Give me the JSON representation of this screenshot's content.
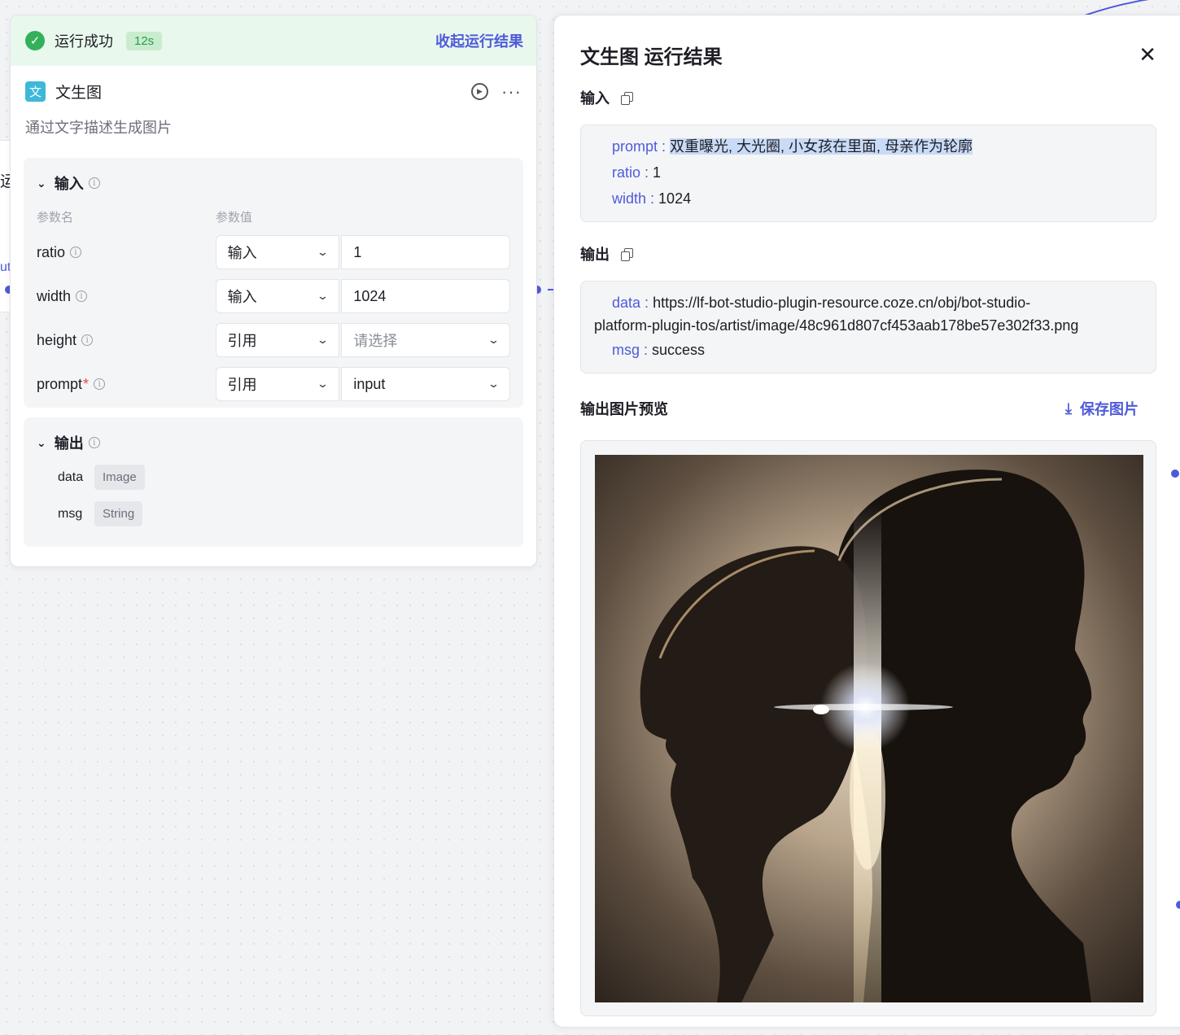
{
  "node": {
    "status": {
      "text": "运行成功",
      "duration": "12s",
      "collapse_link": "收起运行结果"
    },
    "icon_glyph": "文",
    "title": "文生图",
    "description": "通过文字描述生成图片",
    "input_section": {
      "title": "输入",
      "col_name": "参数名",
      "col_value": "参数值",
      "params": [
        {
          "name": "ratio",
          "required": false,
          "type": "输入",
          "value": "1",
          "value_is_select": false,
          "placeholder": false
        },
        {
          "name": "width",
          "required": false,
          "type": "输入",
          "value": "1024",
          "value_is_select": false,
          "placeholder": false
        },
        {
          "name": "height",
          "required": false,
          "type": "引用",
          "value": "请选择",
          "value_is_select": true,
          "placeholder": true
        },
        {
          "name": "prompt",
          "required": true,
          "type": "引用",
          "value": "input",
          "value_is_select": true,
          "placeholder": false
        }
      ],
      "required_mark": "*"
    },
    "output_section": {
      "title": "输出",
      "fields": [
        {
          "name": "data",
          "type": "Image"
        },
        {
          "name": "msg",
          "type": "String"
        }
      ]
    }
  },
  "canvas": {
    "left_stub_text": "运",
    "left_stub_text2": "ut"
  },
  "panel": {
    "title": "文生图 运行结果",
    "input_label": "输入",
    "input_kv": [
      {
        "key": "prompt",
        "value": "双重曝光, 大光圈, 小女孩在里面, 母亲作为轮廓"
      },
      {
        "key": "ratio",
        "value": "1"
      },
      {
        "key": "width",
        "value": "1024"
      }
    ],
    "output_label": "输出",
    "output_data_key": "data",
    "output_data_value_1": "https://lf-bot-studio-plugin-resource.coze.cn/obj/bot-studio-",
    "output_data_value_2": "platform-plugin-tos/artist/image/48c961d807cf453aab178be57e302f33.png",
    "output_msg_key": "msg",
    "output_msg_value": "success",
    "preview_title": "输出图片预览",
    "save_label": "保存图片"
  },
  "colors": {
    "accent": "#4e5bd9",
    "success": "#33b15a",
    "success_bg": "#e9f8ec"
  }
}
